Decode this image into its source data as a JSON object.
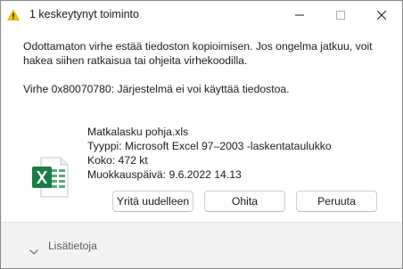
{
  "window": {
    "title": "1 keskeytynyt toiminto"
  },
  "dialog": {
    "message": "Odottamaton virhe estää tiedoston kopioimisen. Jos ongelma jatkuu, voit hakea siihen ratkaisua tai ohjeita virhekoodilla.",
    "error_code": "Virhe 0x80070780: Järjestelmä ei voi käyttää tiedostoa."
  },
  "file": {
    "name": "Matkalasku pohja.xls",
    "type": "Tyyppi: Microsoft Excel 97–2003 -laskentataulukko",
    "size": "Koko: 472 kt",
    "modified": "Muokkauspäivä: 9.6.2022 14.13",
    "icon": "excel-file-icon"
  },
  "buttons": {
    "retry": "Yritä uudelleen",
    "skip": "Ohita",
    "cancel": "Peruuta"
  },
  "footer": {
    "details_label": "Lisätietoja"
  },
  "colors": {
    "excel_green": "#1d7a45",
    "window_border": "#8a8a8a",
    "footer_bg": "#f3f3f3"
  }
}
